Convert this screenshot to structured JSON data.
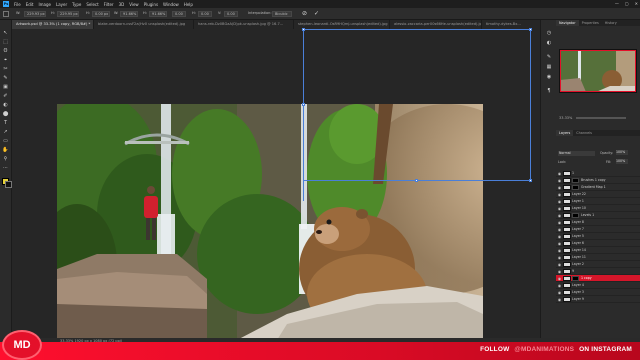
{
  "app": {
    "logo": "Ps",
    "menu": [
      "File",
      "Edit",
      "Image",
      "Layer",
      "Type",
      "Select",
      "Filter",
      "3D",
      "View",
      "Plugins",
      "Window",
      "Help"
    ],
    "window_buttons": [
      "—",
      "▢",
      "✕"
    ]
  },
  "options": {
    "fields": [
      "W:",
      "229.93 px",
      "H:",
      "229.95 px",
      "H:",
      "0.00 px",
      "W:",
      "91.66%",
      "H:",
      "91.66%",
      "0.00",
      "H:",
      "0.00",
      "V:",
      "0.00",
      "Interpolation:",
      "Bicubic"
    ],
    "commit": "✓",
    "cancel": "⊘"
  },
  "tabs": [
    {
      "label": "Artwork.psd @ 33.3% (1 copy, RGB/8#) *",
      "active": true
    },
    {
      "label": "blake-verdoorn-cssF2a(Hv0 unsplash(edited).jpg",
      "active": false
    },
    {
      "label": "hans-reb-Dz0BGaA(D)pk-unsplash.jpg @ 16.7...",
      "active": false
    },
    {
      "label": "stephen-leonardi-OsR9HQmJ-unsplash(edited).jpg",
      "active": false
    },
    {
      "label": "alessio-zaccaria-per00s66He-unsplash(edited).jpg",
      "active": false
    },
    {
      "label": "timothy-dykes-Bx...",
      "active": false
    }
  ],
  "tools": [
    "↖",
    "⬚",
    "ʘ",
    "⌖",
    "✂",
    "✎",
    "▣",
    "✐",
    "◐",
    "⬤",
    "T",
    "↗",
    "▭",
    "✋",
    "⚲",
    "⋯"
  ],
  "right_panel": {
    "navigator_tabs": [
      "Navigator",
      "Properties",
      "History"
    ],
    "zoom": "33.33%",
    "layers_tabs": [
      "Layers",
      "Channels"
    ],
    "blend_mode": "Normal",
    "opacity_label": "Opacity:",
    "opacity": "100%",
    "lock_label": "Lock:",
    "fill_label": "Fill:",
    "fill": "100%",
    "layers": [
      {
        "name": "1",
        "selected": false
      },
      {
        "name": "Brushes 1 copy",
        "selected": false
      },
      {
        "name": "Gradient Map 1",
        "selected": false
      },
      {
        "name": "Layer 22",
        "selected": false
      },
      {
        "name": "Layer 1",
        "selected": false
      },
      {
        "name": "Layer 10",
        "selected": false
      },
      {
        "name": "Levels 1",
        "selected": false
      },
      {
        "name": "Layer 8",
        "selected": false
      },
      {
        "name": "Layer 7",
        "selected": false
      },
      {
        "name": "Layer 5",
        "selected": false
      },
      {
        "name": "Layer 6",
        "selected": false
      },
      {
        "name": "Layer 14",
        "selected": false
      },
      {
        "name": "Layer 11",
        "selected": false
      },
      {
        "name": "Layer 2",
        "selected": false
      },
      {
        "name": "9",
        "selected": false
      },
      {
        "name": "1 copy",
        "selected": true
      },
      {
        "name": "Layer 4",
        "selected": false
      },
      {
        "name": "Layer 3",
        "selected": false
      },
      {
        "name": "Layer 9",
        "selected": false
      }
    ]
  },
  "status": {
    "zoom_doc": "33.33%   1920 px x 1080 px (72 ppi)"
  },
  "branding": {
    "logo_text": "MD",
    "follow": "FOLLOW",
    "handle": "@MDANIMATIONS",
    "on": "ON INSTAGRAM",
    "accent": "#e4102a"
  }
}
